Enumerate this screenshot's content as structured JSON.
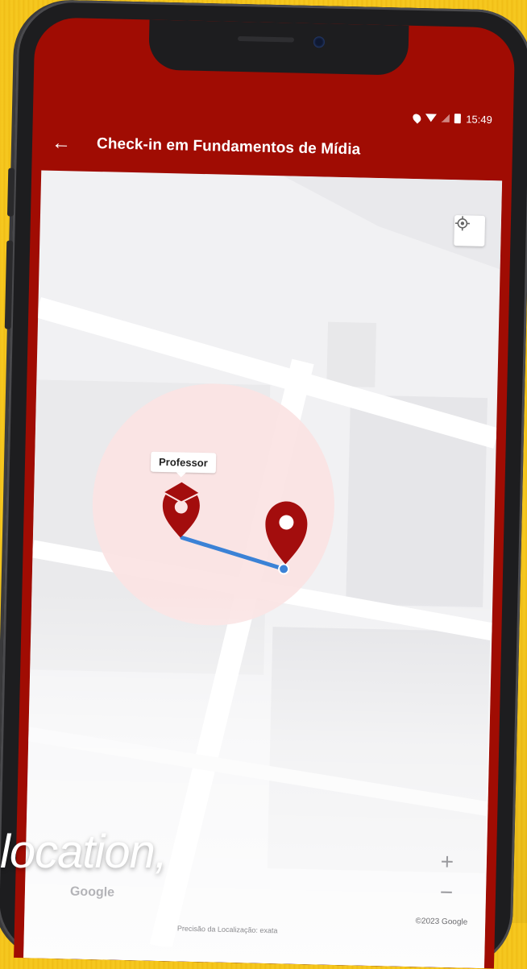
{
  "status_bar": {
    "time": "15:49"
  },
  "app_bar": {
    "back_icon": "arrow-left-icon",
    "title": "Check-in em Fundamentos de Mídia"
  },
  "map": {
    "locate_icon": "my-location-icon",
    "teacher_label": "Professor",
    "teacher_marker_icon": "graduation-cap-pin-icon",
    "student_marker_icon": "location-pin-icon",
    "zoom_in_label": "+",
    "zoom_out_label": "−",
    "google_logo": "Google",
    "copyright": "©2023 Google",
    "precision_text": "Precisão da Localização: exata",
    "colors": {
      "brand": "#a00c03",
      "route": "#3b82d6",
      "radius_fill": "#fbe3e3"
    }
  },
  "caption": "location,"
}
